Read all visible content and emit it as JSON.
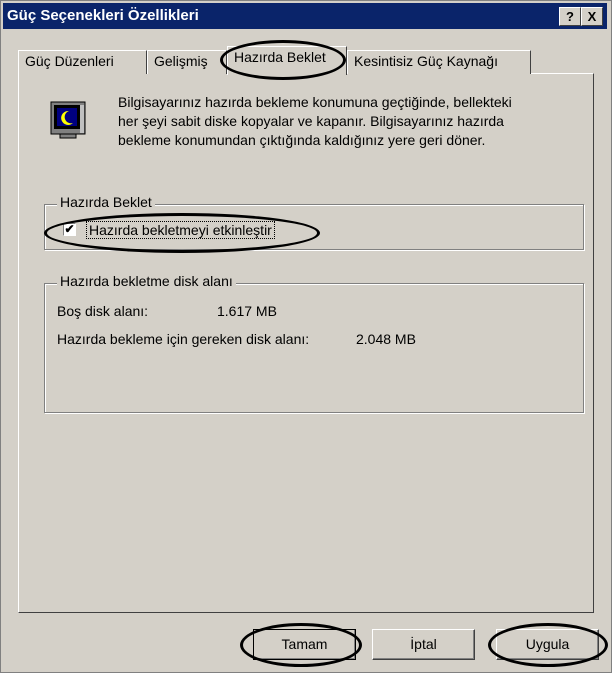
{
  "window": {
    "title": "Güç Seçenekleri Özellikleri",
    "help_label": "?",
    "close_label": "X"
  },
  "tabs": [
    {
      "label": "Güç Düzenleri"
    },
    {
      "label": "Gelişmiş"
    },
    {
      "label": "Hazırda Beklet",
      "selected": true
    },
    {
      "label": "Kesintisiz Güç Kaynağı"
    }
  ],
  "info": {
    "icon": "monitor-moon-icon",
    "line1": "Bilgisayarınız hazırda bekleme konumuna geçtiğinde, bellekteki",
    "line2": "her şeyi sabit diske kopyalar ve kapanır. Bilgisayarınız hazırda",
    "line3": "bekleme konumundan çıktığında kaldığınız yere geri döner."
  },
  "hibernate_group": {
    "label": "Hazırda Beklet",
    "checkbox_label": "Hazırda bekletmeyi etkinleştir",
    "checked": true
  },
  "disk_group": {
    "label": "Hazırda bekletme disk alanı",
    "free_label": "Boş disk alanı:",
    "free_value": "1.617 MB",
    "required_label": "Hazırda bekleme için gereken disk alanı:",
    "required_value": "2.048 MB"
  },
  "buttons": {
    "ok": "Tamam",
    "cancel": "İptal",
    "apply": "Uygula"
  },
  "colors": {
    "titlebar": "#0a246a",
    "dialog_bg": "#d4d0c8"
  }
}
